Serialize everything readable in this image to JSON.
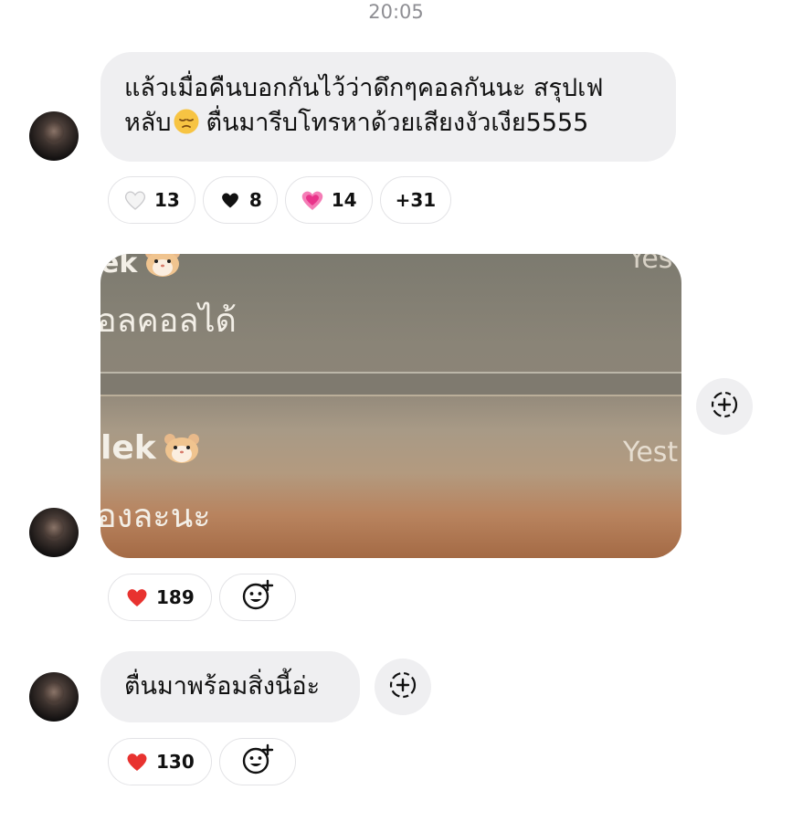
{
  "timestamp": "20:05",
  "messages": [
    {
      "line1": "แล้วเมื่อคืนบอกกันไว้ว่าดึกๆคอลกันนะ สรุปเฟ",
      "line2_before": "หลับ",
      "line2_after": "ตื่นมารีบโทรหาด้วยเสียงงัวเงีย5555",
      "inline_emoji": "pensive-face-emoji",
      "reactions": [
        {
          "emoji": "white-heart",
          "count": "13"
        },
        {
          "emoji": "black-heart",
          "count": "8"
        },
        {
          "emoji": "growing-heart",
          "count": "14"
        },
        {
          "label": "+31"
        }
      ]
    },
    {
      "type": "image",
      "image_text": {
        "name_top": "ek",
        "msg_top": "อลคอลได้",
        "time_top": "Yes",
        "name_bottom": "lek",
        "time_bottom": "Yest",
        "msg_bottom": "องละนะ"
      },
      "reactions": [
        {
          "emoji": "red-heart",
          "count": "189"
        }
      ]
    },
    {
      "text": "ตื่นมาพร้อมสิ่งนี้อ่ะ",
      "reactions": [
        {
          "emoji": "red-heart",
          "count": "130"
        }
      ]
    }
  ],
  "colors": {
    "bubble_bg": "#efeff1",
    "timestamp": "#8e8e93",
    "heart_red": "#e8322f",
    "heart_pink": "#f0509a"
  }
}
